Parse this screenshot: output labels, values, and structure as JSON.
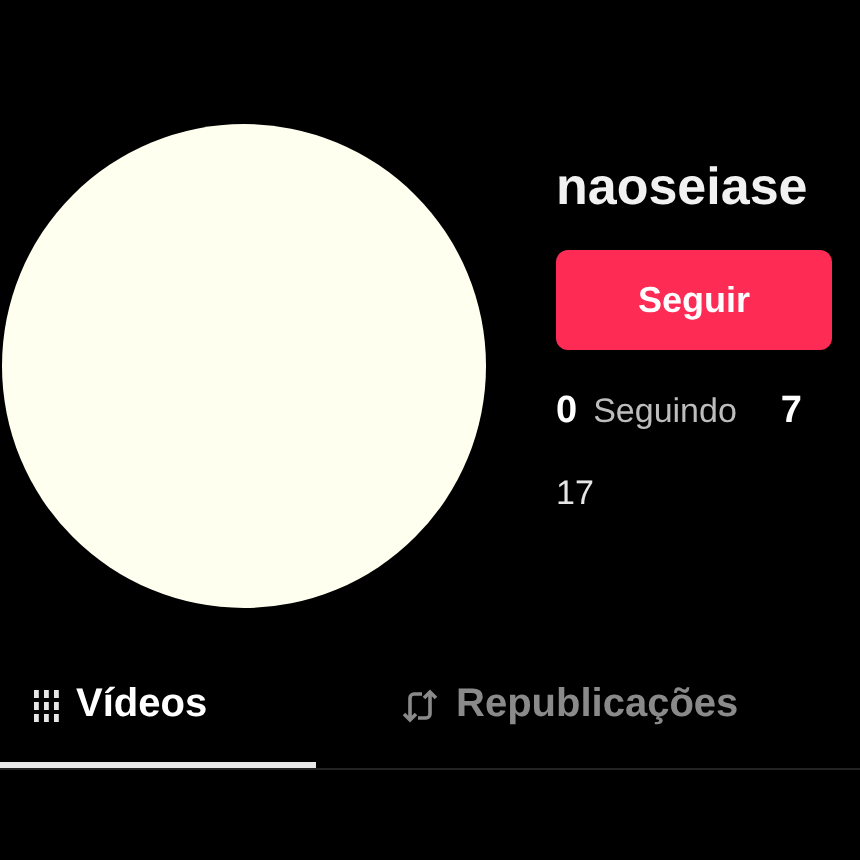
{
  "profile": {
    "username": "naoseiase",
    "follow_button": "Seguir",
    "stats": [
      {
        "value": "0",
        "label": "Seguindo"
      },
      {
        "value": "7"
      }
    ],
    "bio": "17"
  },
  "tabs": [
    {
      "label": "Vídeos",
      "kind": "grid",
      "selected": true
    },
    {
      "label": "Republicações",
      "kind": "repost",
      "selected": false
    }
  ]
}
